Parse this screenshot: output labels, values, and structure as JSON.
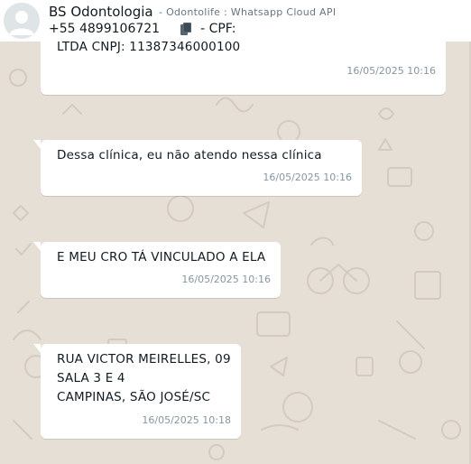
{
  "header": {
    "contact_name": "BS Odontologia",
    "contact_source": "- Odontolife : Whatsapp Cloud API",
    "phone": "+55 4899106721",
    "cpf_label": "- CPF:"
  },
  "messages": [
    {
      "text": "LTDA CNPJ: 11387346000100",
      "time": "16/05/2025 10:16"
    },
    {
      "text": "Dessa clínica, eu não atendo nessa clínica",
      "time": "16/05/2025 10:16"
    },
    {
      "text": "E MEU CRO TÁ VINCULADO A ELA",
      "time": "16/05/2025 10:16"
    },
    {
      "text": "RUA VICTOR MEIRELLES, 09\nSALA 3 E 4\nCAMPINAS, SÃO JOSÉ/SC",
      "time": "16/05/2025 10:18"
    }
  ],
  "colors": {
    "chat_background": "#e6dfd6",
    "bubble": "#ffffff",
    "timestamp": "#8696a0"
  }
}
